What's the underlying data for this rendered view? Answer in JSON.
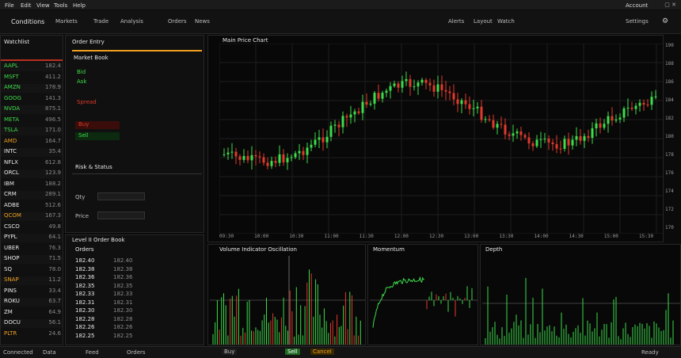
{
  "menubar": {
    "items": [
      "File",
      "Edit",
      "View",
      "Tools",
      "Help"
    ],
    "right": "Account"
  },
  "toolbar": {
    "title": "Conditions",
    "tabs": [
      "Markets",
      "Trade",
      "Analysis",
      "Orders",
      "News"
    ],
    "right": [
      "Alerts",
      "Layout",
      "Watch",
      "Settings"
    ]
  },
  "watchlist": {
    "header": "Watchlist",
    "rows": [
      {
        "sym": "AAPL",
        "val": "182.4",
        "color": "g"
      },
      {
        "sym": "MSFT",
        "val": "411.2",
        "color": "g"
      },
      {
        "sym": "AMZN",
        "val": "178.9",
        "color": "g"
      },
      {
        "sym": "GOOG",
        "val": "141.3",
        "color": "g"
      },
      {
        "sym": "NVDA",
        "val": "875.1",
        "color": "g"
      },
      {
        "sym": "META",
        "val": "496.5",
        "color": "g"
      },
      {
        "sym": "TSLA",
        "val": "171.0",
        "color": "g"
      },
      {
        "sym": "AMD",
        "val": "164.7",
        "color": "o"
      },
      {
        "sym": "INTC",
        "val": "35.4",
        "color": "w"
      },
      {
        "sym": "NFLX",
        "val": "612.8",
        "color": "w"
      },
      {
        "sym": "ORCL",
        "val": "123.9",
        "color": "w"
      },
      {
        "sym": "IBM",
        "val": "188.2",
        "color": "w"
      },
      {
        "sym": "CRM",
        "val": "289.1",
        "color": "w"
      },
      {
        "sym": "ADBE",
        "val": "512.6",
        "color": "w"
      },
      {
        "sym": "QCOM",
        "val": "167.3",
        "color": "o"
      },
      {
        "sym": "CSCO",
        "val": "49.8",
        "color": "w"
      },
      {
        "sym": "PYPL",
        "val": "64.1",
        "color": "w"
      },
      {
        "sym": "UBER",
        "val": "76.3",
        "color": "w"
      },
      {
        "sym": "SHOP",
        "val": "71.5",
        "color": "w"
      },
      {
        "sym": "SQ",
        "val": "78.0",
        "color": "w"
      },
      {
        "sym": "SNAP",
        "val": "11.2",
        "color": "o"
      },
      {
        "sym": "PINS",
        "val": "33.4",
        "color": "w"
      },
      {
        "sym": "ROKU",
        "val": "63.7",
        "color": "w"
      },
      {
        "sym": "ZM",
        "val": "64.9",
        "color": "w"
      },
      {
        "sym": "DOCU",
        "val": "56.1",
        "color": "w"
      },
      {
        "sym": "PLTR",
        "val": "24.6",
        "color": "o"
      }
    ]
  },
  "order_panel": {
    "title": "Order Entry",
    "subtitle": "Market Book",
    "lines": [
      "Bid",
      "Ask",
      "Spread"
    ],
    "buy": "Buy",
    "sell": "Sell",
    "section": "Risk & Status",
    "qty_label": "Qty",
    "price_label": "Price"
  },
  "book": {
    "title": "Level II Order Book",
    "header": "Orders",
    "rows": [
      "182.40",
      "182.38",
      "182.36",
      "182.35",
      "182.33",
      "182.31",
      "182.30",
      "182.28",
      "182.26",
      "182.25"
    ]
  },
  "main_chart": {
    "title": "Main Price Chart",
    "y_ticks": [
      "190",
      "188",
      "186",
      "184",
      "182",
      "180",
      "178",
      "176",
      "174",
      "172",
      "170"
    ],
    "x_ticks": [
      "09:30",
      "10:00",
      "10:30",
      "11:00",
      "11:30",
      "12:00",
      "12:30",
      "13:00",
      "13:30",
      "14:00",
      "14:30",
      "15:00",
      "15:30"
    ]
  },
  "sub_charts": {
    "left_title": "Volume Indicator Oscillation",
    "mid_title": "Momentum",
    "right_title": "Depth"
  },
  "statusbar": {
    "left": [
      "Connected",
      "Data",
      "Feed",
      "Orders"
    ],
    "center": [
      "Buy",
      "Sell",
      "Cancel"
    ],
    "right": "Ready"
  },
  "colors": {
    "up": "#3ddc4a",
    "down": "#e03a2c",
    "accent": "#f0a020",
    "bg": "#0b0b0b"
  }
}
